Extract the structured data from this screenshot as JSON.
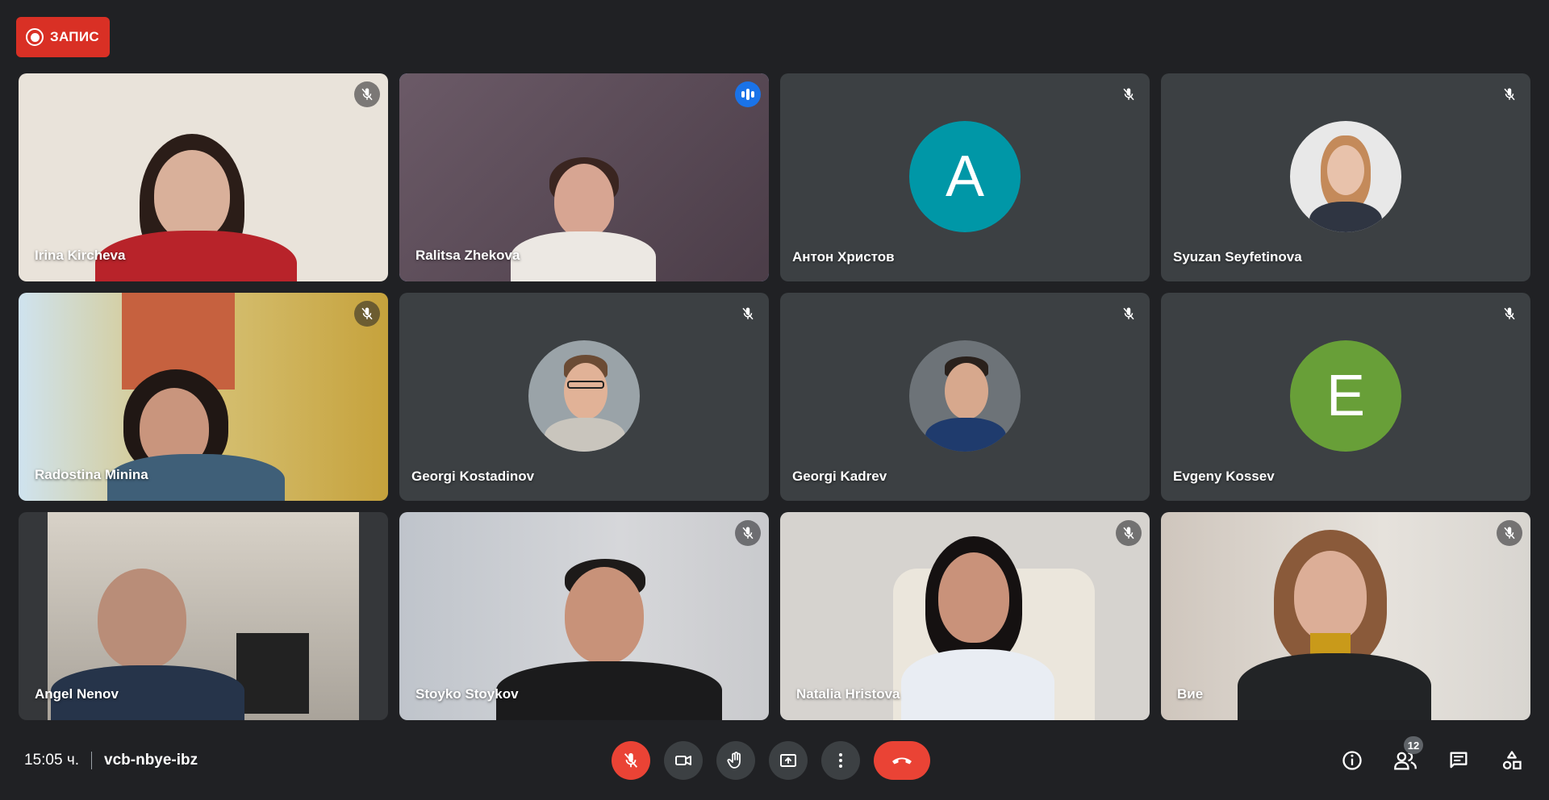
{
  "recording": {
    "label": "ЗАПИС"
  },
  "participants": [
    {
      "name": "Irina Kircheva",
      "state": "muted",
      "video": true
    },
    {
      "name": "Ralitsa Zhekova",
      "state": "speaking",
      "video": true
    },
    {
      "name": "Антон Христов",
      "state": "muted",
      "video": false,
      "avatar_letter": "A",
      "avatar_color": "#0097a7"
    },
    {
      "name": "Syuzan Seyfetinova",
      "state": "muted",
      "video": false,
      "avatar_photo": true
    },
    {
      "name": "Radostina Minina",
      "state": "muted",
      "video": true
    },
    {
      "name": "Georgi Kostadinov",
      "state": "muted",
      "video": false,
      "avatar_photo": true
    },
    {
      "name": "Georgi Kadrev",
      "state": "muted",
      "video": false,
      "avatar_photo": true
    },
    {
      "name": "Evgeny Kossev",
      "state": "muted",
      "video": false,
      "avatar_letter": "E",
      "avatar_color": "#689f38"
    },
    {
      "name": "Angel Nenov",
      "state": "none",
      "video": true
    },
    {
      "name": "Stoyko Stoykov",
      "state": "muted",
      "video": true
    },
    {
      "name": "Natalia Hristova",
      "state": "muted",
      "video": true
    },
    {
      "name": "Вие",
      "state": "muted",
      "video": true
    }
  ],
  "bottom_bar": {
    "time": "15:05 ч.",
    "meeting_code": "vcb-nbye-ibz",
    "controls": [
      "mic-off-icon",
      "camera-icon",
      "raise-hand-icon",
      "present-icon",
      "more-options-icon",
      "end-call-icon"
    ],
    "participants_count": "12"
  },
  "colors": {
    "background": "#202124",
    "tile": "#3c4043",
    "danger": "#ea4335",
    "speaking_accent": "#8ab4f8"
  }
}
